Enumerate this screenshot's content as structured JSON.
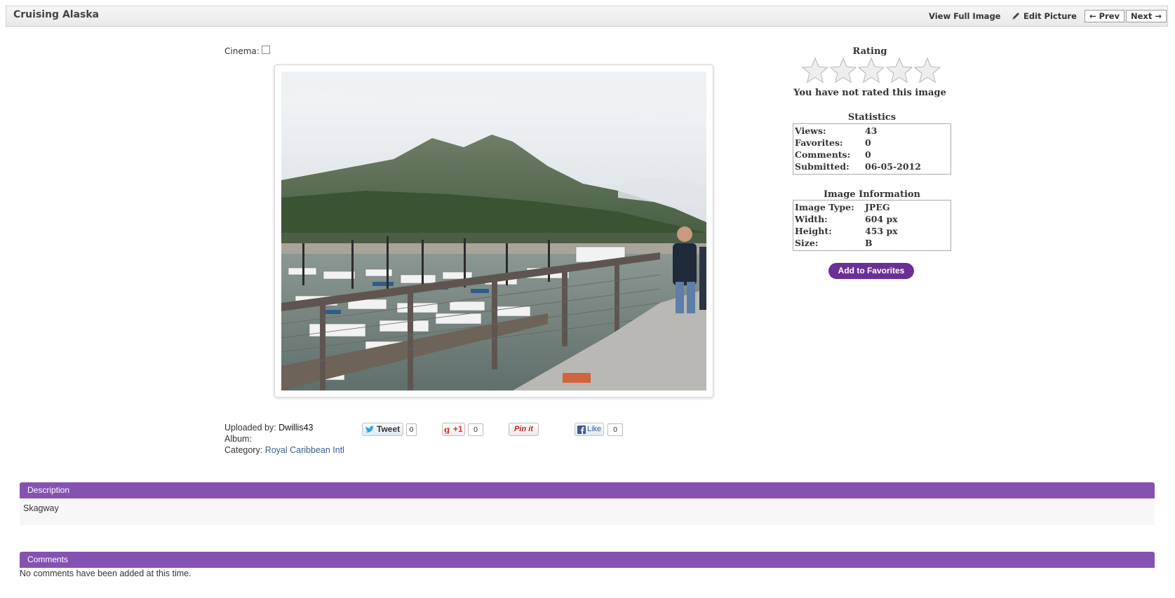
{
  "header": {
    "title": "Cruising Alaska",
    "view_full_image": "View Full Image",
    "edit_picture": "Edit Picture",
    "prev": "← Prev",
    "next": "Next →"
  },
  "cinema": {
    "label": "Cinema:",
    "checked": false
  },
  "rating": {
    "title": "Rating",
    "stars_total": 5,
    "stars_filled": 0,
    "message": "You have not rated this image"
  },
  "statistics": {
    "title": "Statistics",
    "rows": [
      {
        "label": "Views:",
        "value": "43"
      },
      {
        "label": "Favorites:",
        "value": "0"
      },
      {
        "label": "Comments:",
        "value": "0"
      },
      {
        "label": "Submitted:",
        "value": "06-05-2012"
      }
    ]
  },
  "image_info": {
    "title": "Image Information",
    "rows": [
      {
        "label": "Image Type:",
        "value": "JPEG"
      },
      {
        "label": "Width:",
        "value": "604 px"
      },
      {
        "label": "Height:",
        "value": "453 px"
      },
      {
        "label": "Size:",
        "value": "B"
      }
    ]
  },
  "favorites_button": "Add to Favorites",
  "meta": {
    "uploaded_by_label": "Uploaded by:",
    "uploaded_by": "Dwillis43",
    "album_label": "Album:",
    "album": "",
    "category_label": "Category:",
    "category": "Royal Caribbean Intl"
  },
  "social": {
    "tweet_label": "Tweet",
    "tweet_count": "0",
    "gplus_label": "+1",
    "gplus_count": "0",
    "pin_label": "Pin it",
    "like_label": "Like",
    "like_count": "0"
  },
  "description": {
    "title": "Description",
    "text": "Skagway"
  },
  "comments": {
    "title": "Comments",
    "text": "No comments have been added at this time."
  },
  "colors": {
    "accent": "#8652b1",
    "button": "#6c2f96"
  }
}
